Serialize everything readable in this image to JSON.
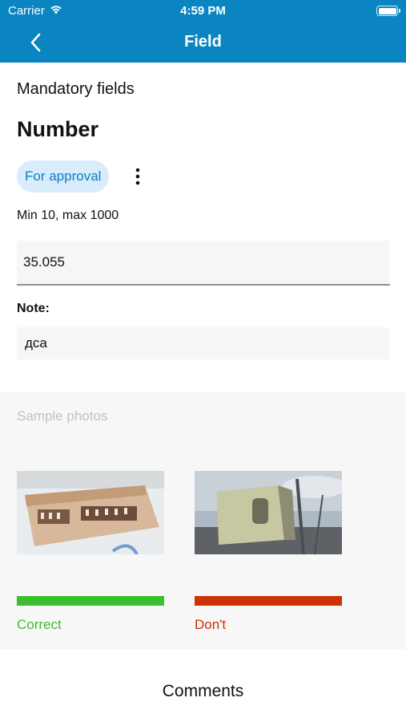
{
  "status_bar": {
    "carrier": "Carrier",
    "time": "4:59 PM"
  },
  "nav": {
    "title": "Field",
    "back_icon": "chevron-left-icon"
  },
  "section": {
    "label": "Mandatory fields"
  },
  "field": {
    "title": "Number",
    "status_chip": "For approval",
    "range_text": "Min 10, max 1000",
    "value": "35.055",
    "note_label": "Note:",
    "note_value": "дса"
  },
  "samples": {
    "label": "Sample photos",
    "items": [
      {
        "caption": "Correct",
        "color": "#3cbf2e"
      },
      {
        "caption": "Don't",
        "color": "#cc3300"
      }
    ]
  },
  "footer": {
    "comments_label": "Comments"
  },
  "colors": {
    "accent": "#0a85c2",
    "chip_bg": "#d9ecfb",
    "chip_text": "#0b7fc0"
  }
}
